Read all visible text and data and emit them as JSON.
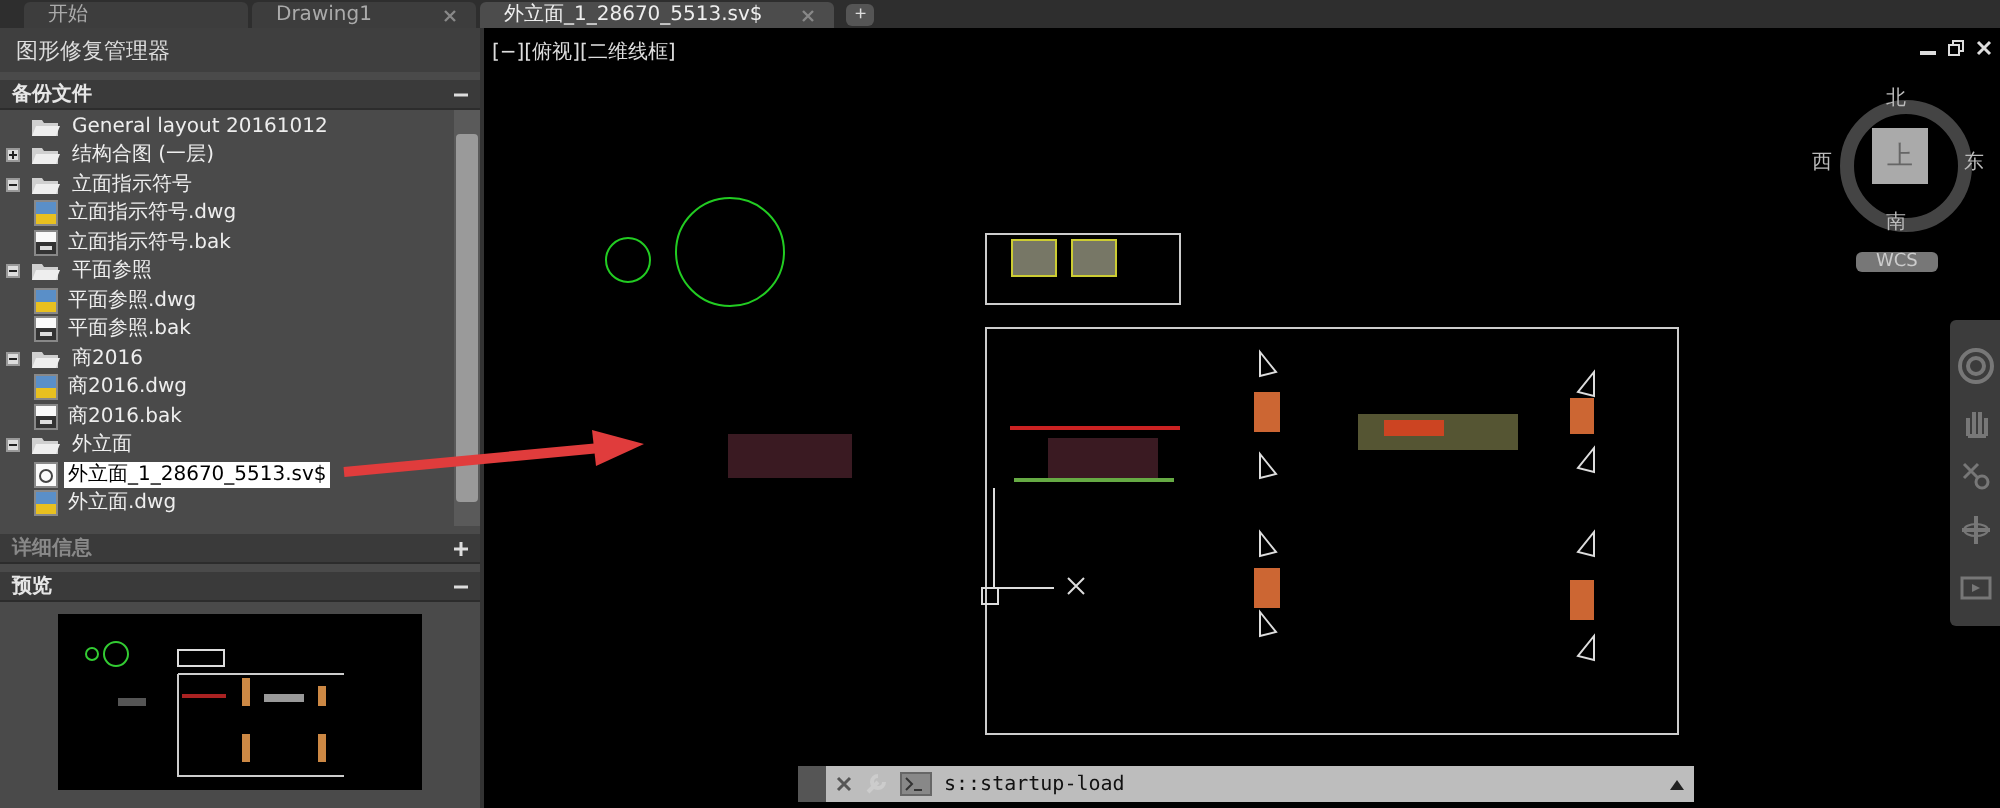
{
  "tabs": [
    {
      "label": "开始",
      "closable": false,
      "selected": false
    },
    {
      "label": "Drawing1",
      "closable": true,
      "selected": false
    },
    {
      "label": "外立面_1_28670_5513.sv$",
      "closable": true,
      "selected": true
    }
  ],
  "new_tab": "+",
  "panel": {
    "title": "图形修复管理器",
    "sections": [
      {
        "label": "备份文件",
        "expanded": true,
        "disabled": false
      },
      {
        "label": "详细信息",
        "expanded": false,
        "disabled": true
      },
      {
        "label": "预览",
        "expanded": true,
        "disabled": false
      }
    ],
    "tree": [
      {
        "kind": "folder",
        "label": "General layout 20161012",
        "selected": false
      },
      {
        "kind": "folder",
        "label": "结构合图 (一层)",
        "expanded": false,
        "selected": false
      },
      {
        "kind": "folder",
        "label": "立面指示符号",
        "expanded": true,
        "selected": false,
        "children": [
          {
            "kind": "dwg",
            "label": "立面指示符号.dwg",
            "selected": false
          },
          {
            "kind": "bak",
            "label": "立面指示符号.bak",
            "selected": false
          }
        ]
      },
      {
        "kind": "folder",
        "label": "平面参照",
        "expanded": true,
        "selected": false,
        "children": [
          {
            "kind": "dwg",
            "label": "平面参照.dwg",
            "selected": false
          },
          {
            "kind": "bak",
            "label": "平面参照.bak",
            "selected": false
          }
        ]
      },
      {
        "kind": "folder",
        "label": "商2016",
        "expanded": true,
        "selected": false,
        "children": [
          {
            "kind": "dwg",
            "label": "商2016.dwg",
            "selected": false
          },
          {
            "kind": "bak",
            "label": "商2016.bak",
            "selected": false
          }
        ]
      },
      {
        "kind": "folder",
        "label": "外立面",
        "expanded": true,
        "selected": false,
        "children": [
          {
            "kind": "sv",
            "label": "外立面_1_28670_5513.sv$",
            "selected": true
          },
          {
            "kind": "dwg",
            "label": "外立面.dwg",
            "selected": false
          }
        ]
      }
    ]
  },
  "viewport": {
    "label": "[−][俯视][二维线框]"
  },
  "viewcube": {
    "north": "北",
    "south": "南",
    "east": "东",
    "west": "西",
    "face": "上",
    "wcs": "WCS"
  },
  "command_line": {
    "text": "s::startup-load"
  }
}
